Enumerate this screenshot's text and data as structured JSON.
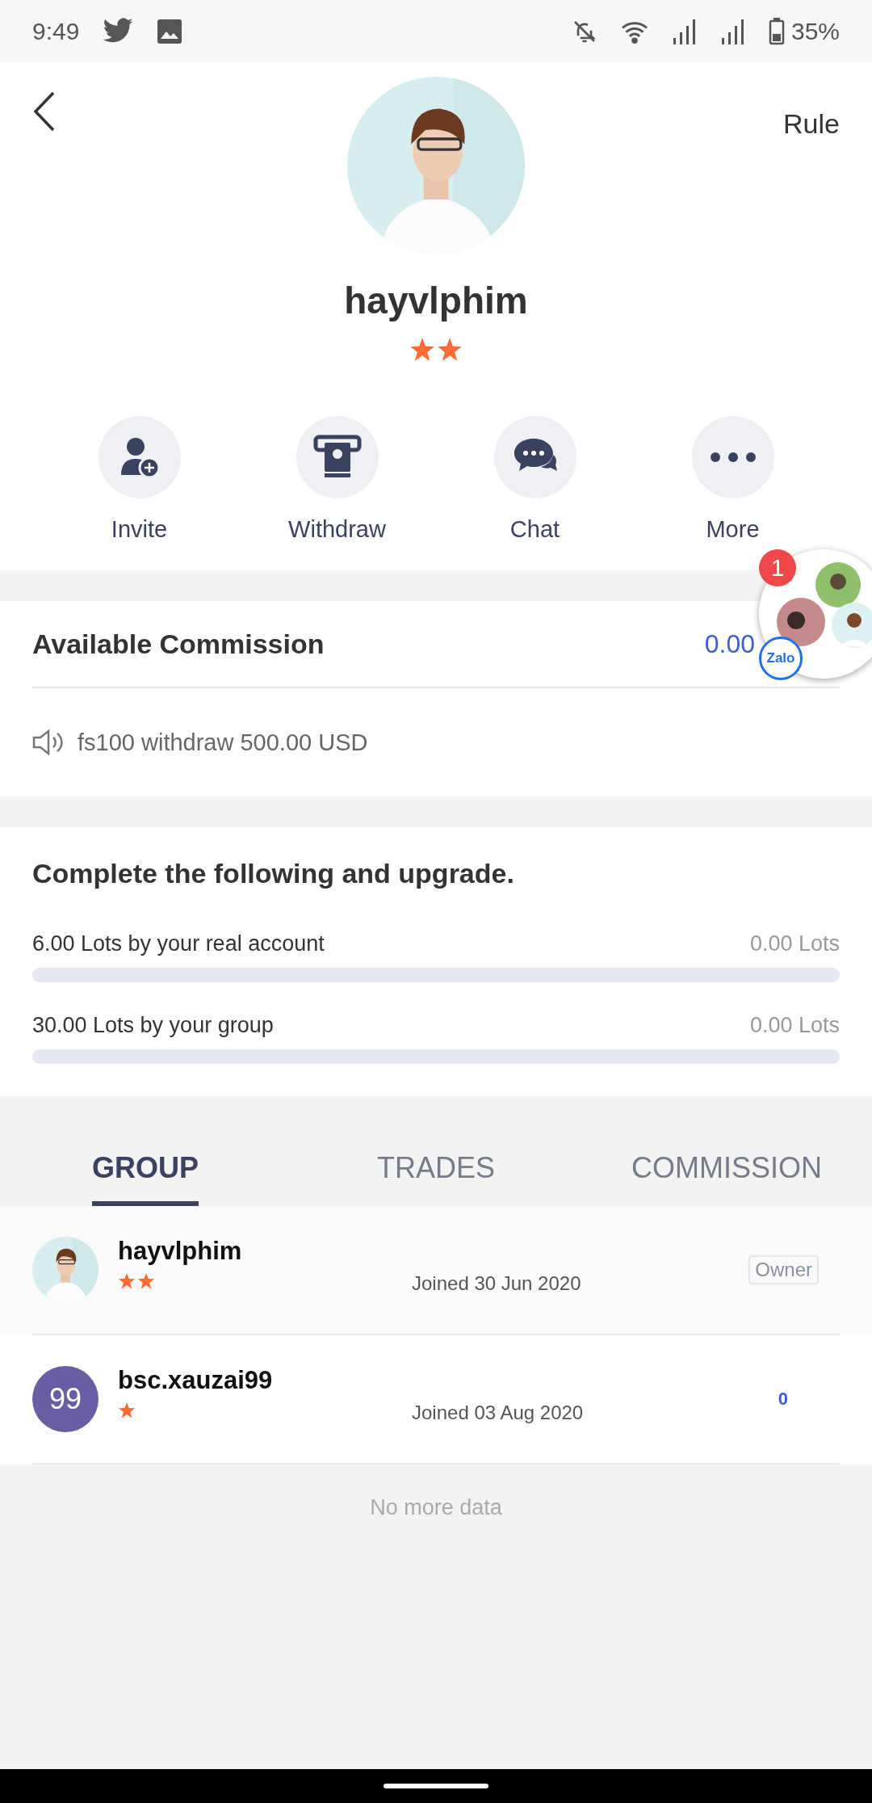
{
  "status_bar": {
    "time": "9:49",
    "battery": "35%"
  },
  "header": {
    "action": "Rule"
  },
  "profile": {
    "name": "hayvlphim",
    "rank_marks": [
      {
        "kind": "star"
      },
      {
        "kind": "star"
      }
    ]
  },
  "actions": [
    {
      "label": "Invite",
      "kind": "invite"
    },
    {
      "label": "Withdraw",
      "kind": "withdraw"
    },
    {
      "label": "Chat",
      "kind": "chat"
    },
    {
      "label": "More",
      "kind": "more"
    }
  ],
  "commission": {
    "title": "Available Commission",
    "value": "0.00",
    "notice": "fs100 withdraw 500.00 USD"
  },
  "upgrade": {
    "title": "Complete the following and upgrade.",
    "tasks": [
      {
        "label": "6.00 Lots by your real account",
        "reading": "0.00 Lots",
        "level": 0
      },
      {
        "label": "30.00 Lots by your group",
        "reading": "0.00 Lots",
        "level": 0
      }
    ]
  },
  "tabs": [
    {
      "label": "GROUP",
      "selected": true
    },
    {
      "label": "TRADES",
      "selected": false
    },
    {
      "label": "COMMISSION",
      "selected": false
    }
  ],
  "members": [
    {
      "kind": "owner",
      "name": "hayvlphim",
      "rank_marks": [
        {
          "kind": "star"
        },
        {
          "kind": "star"
        }
      ],
      "joined": "Joined 30 Jun 2020",
      "avatar": {
        "kind": "picture"
      },
      "tag": "Owner"
    },
    {
      "kind": "member",
      "name": "bsc.xauzai99",
      "rank_marks": [
        {
          "kind": "star"
        }
      ],
      "joined": "Joined 03 Aug 2020",
      "avatar": {
        "kind": "initials",
        "text": "99",
        "color": "#675ea3"
      },
      "count": "0"
    }
  ],
  "footer": "No more data",
  "chat_bubble": {
    "badge": "1",
    "logo": "Zalo"
  }
}
